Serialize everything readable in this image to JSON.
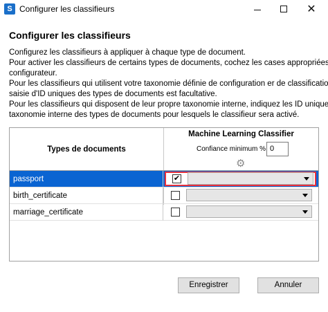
{
  "window": {
    "title": "Configurer les classifieurs",
    "icon_letter": "S",
    "controls": {
      "minimize": "minimize-icon",
      "maximize": "maximize-icon",
      "close": "close-icon"
    }
  },
  "heading": "Configurer les classifieurs",
  "description": [
    "Configurez les classifieurs à appliquer à chaque type de document.",
    "Pour activer les classifieurs de certains types de documents, cochez les cases appropriées du",
    "configurateur.",
    "Pour les classifieurs qui utilisent votre taxonomie définie de configuration er de classification, la",
    "saisie d'ID uniques des types de documents est facultative.",
    "Pour les classifieurs qui disposent de leur propre taxonomie interne, indiquez les ID uniques de",
    "taxonomie interne des types de documents pour lesquels le classifieur sera activé."
  ],
  "grid": {
    "doc_types_header": "Types de documents",
    "classifier_header": "Machine Learning Classifier",
    "confidence_label": "Confiance minimum %",
    "confidence_value": "0",
    "settings_icon": "gear-icon",
    "rows": [
      {
        "name": "passport",
        "checked": true,
        "selected": true,
        "value": ""
      },
      {
        "name": "birth_certificate",
        "checked": false,
        "selected": false,
        "value": ""
      },
      {
        "name": "marriage_certificate",
        "checked": false,
        "selected": false,
        "value": ""
      }
    ]
  },
  "buttons": {
    "save": "Enregistrer",
    "cancel": "Annuler"
  },
  "colors": {
    "selection": "#0a64d2",
    "highlight_border": "#e8323c",
    "app_icon": "#1a6fc9"
  }
}
